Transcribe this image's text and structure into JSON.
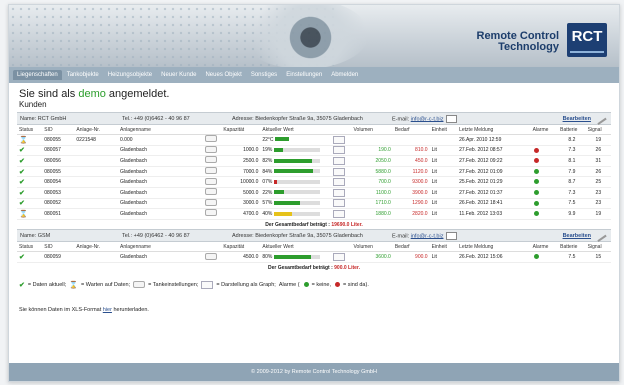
{
  "brand": {
    "line1": "Remote Control",
    "line2": "Technology",
    "logo": "RCT"
  },
  "nav": [
    "Liegenschaften",
    "Tankobjekte",
    "Heizungsobjekte",
    "Neuer Kunde",
    "Neues Objekt",
    "Sonstiges",
    "Einstellungen",
    "Abmelden"
  ],
  "hello": {
    "prefix": "Sie sind als",
    "demo": "demo",
    "suffix": "angemeldet."
  },
  "section_title": "Kunden",
  "columns": [
    "Status",
    "SID",
    "Anlage-Nr.",
    "Anlagenname",
    "",
    "Kapazität",
    "Aktueller Wert",
    "",
    "Volumen",
    "Bedarf",
    "Einheit",
    "Letzte Meldung",
    "Alarme",
    "Batterie",
    "Signal"
  ],
  "customers": [
    {
      "name": "Name: RCT GmbH",
      "tel": "Tel.: +49 (0)6462 - 40 96 87",
      "address": "Adresse: Biedenkopfer Straße 9a, 35075 Gladenbach",
      "email_label": "E-mail:",
      "email": "info@r-c-t.biz",
      "edit": "Bearbeiten",
      "rows": [
        {
          "status": "wait",
          "sid": "080055",
          "nr": "0221548",
          "name": "0.000",
          "kap": "",
          "pct": "",
          "val_text": "22°C",
          "fill": 0,
          "color": "#2d9d2d",
          "vol": "",
          "bedarf": "",
          "unit": "",
          "last": "26.Apr. 2010 12:59",
          "last_color": "#333",
          "alarm": "",
          "batt": "8.2",
          "sig": "19"
        },
        {
          "status": "ok",
          "sid": "080057",
          "nr": "",
          "name": "Gladenbach",
          "kap": "1000.0",
          "pct": "19%",
          "val_text": "",
          "fill": 0.19,
          "color": "#2d9d2d",
          "vol": "190.0",
          "bedarf": "810.0",
          "unit": "Lit",
          "last": "27.Feb. 2012 08:57",
          "last_color": "#c62828",
          "alarm": "#c62828",
          "batt": "7.3",
          "sig": "26"
        },
        {
          "status": "ok",
          "sid": "080056",
          "nr": "",
          "name": "Gladenbach",
          "kap": "2500.0",
          "pct": "82%",
          "val_text": "",
          "fill": 0.82,
          "color": "#2d9d2d",
          "vol": "2050.0",
          "bedarf": "450.0",
          "unit": "Lit",
          "last": "27.Feb. 2012 09:22",
          "last_color": "#c62828",
          "alarm": "#c62828",
          "batt": "8.1",
          "sig": "31"
        },
        {
          "status": "ok",
          "sid": "080055",
          "nr": "",
          "name": "Gladenbach",
          "kap": "7000.0",
          "pct": "84%",
          "val_text": "",
          "fill": 0.84,
          "color": "#2d9d2d",
          "vol": "5880.0",
          "bedarf": "1120.0",
          "unit": "Lit",
          "last": "27.Feb. 2012 01:09",
          "last_color": "#c62828",
          "alarm": "#2d9d2d",
          "batt": "7.9",
          "sig": "26"
        },
        {
          "status": "ok",
          "sid": "080054",
          "nr": "",
          "name": "Gladenbach",
          "kap": "10000.0",
          "pct": "07%",
          "val_text": "",
          "fill": 0.07,
          "color": "#c62828",
          "vol": "700.0",
          "bedarf": "9300.0",
          "unit": "Lit",
          "last": "25.Feb. 2012 01:29",
          "last_color": "#c62828",
          "alarm": "#2d9d2d",
          "batt": "8.7",
          "sig": "25"
        },
        {
          "status": "ok",
          "sid": "080053",
          "nr": "",
          "name": "Gladenbach",
          "kap": "5000.0",
          "pct": "22%",
          "val_text": "",
          "fill": 0.22,
          "color": "#2d9d2d",
          "vol": "1100.0",
          "bedarf": "3900.0",
          "unit": "Lit",
          "last": "27.Feb. 2012 01:37",
          "last_color": "#c62828",
          "alarm": "#2d9d2d",
          "batt": "7.3",
          "sig": "23"
        },
        {
          "status": "ok",
          "sid": "080052",
          "nr": "",
          "name": "Gladenbach",
          "kap": "3000.0",
          "pct": "57%",
          "val_text": "",
          "fill": 0.57,
          "color": "#2d9d2d",
          "vol": "1710.0",
          "bedarf": "1290.0",
          "unit": "Lit",
          "last": "26.Feb. 2012 18:41",
          "last_color": "#c62828",
          "alarm": "#2d9d2d",
          "batt": "7.5",
          "sig": "23"
        },
        {
          "status": "wait",
          "sid": "080051",
          "nr": "",
          "name": "Gladenbach",
          "kap": "4700.0",
          "pct": "40%",
          "val_text": "",
          "fill": 0.4,
          "color": "#e6c21a",
          "vol": "1880.0",
          "bedarf": "2820.0",
          "unit": "Lit",
          "last": "11.Feb. 2012 13:03",
          "last_color": "#c62828",
          "alarm": "#2d9d2d",
          "batt": "9.9",
          "sig": "19"
        }
      ],
      "total_label": "Der Gesamtbedarf beträgt :",
      "total_value": "19690.0 Liter."
    },
    {
      "name": "Name: GSM",
      "tel": "Tel.: +49 (0)6462 - 40 96 87",
      "address": "Adresse: Biedenkopfer Straße 9a, 35075 Gladenbach",
      "email_label": "E-mail:",
      "email": "info@r-c-t.biz",
      "edit": "Bearbeiten",
      "rows": [
        {
          "status": "ok",
          "sid": "080059",
          "nr": "",
          "name": "Gladenbach",
          "kap": "4500.0",
          "pct": "80%",
          "val_text": "",
          "fill": 0.8,
          "color": "#2d9d2d",
          "vol": "3600.0",
          "bedarf": "900.0",
          "unit": "Lit",
          "last": "26.Feb. 2012 15:06",
          "last_color": "#c62828",
          "alarm": "#2d9d2d",
          "batt": "7.5",
          "sig": "15"
        }
      ],
      "total_label": "Der Gesamtbedarf beträgt :",
      "total_value": "900.0 Liter."
    }
  ],
  "legend": {
    "aktuell": "= Daten aktuell;",
    "warten": "= Warten auf Daten;",
    "tank": "= Tankeinstellungen;",
    "graph": "= Darstellung als Graph;",
    "alarme_prefix": "Alarme (",
    "keine": "= keine,",
    "sind": "= sind da)."
  },
  "download": {
    "prefix": "Sie können Daten im XLS-Format",
    "link": "hier",
    "suffix": "herunterladen."
  },
  "footer": "© 2009-2012 by Remote Control Technology GmbH"
}
